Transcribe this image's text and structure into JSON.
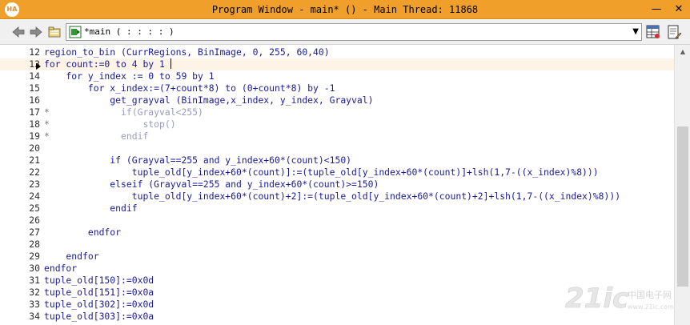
{
  "window": {
    "title": "Program Window - main* () - Main Thread: 11868",
    "app_icon": "HA",
    "minimize_glyph": "—",
    "close_glyph": "✕"
  },
  "toolbar": {
    "back_icon": "arrow-left-icon",
    "forward_icon": "arrow-right-icon",
    "procedure_value": "*main ( : : : : )",
    "dropdown_icon": "chevron-down-icon"
  },
  "editor": {
    "current_line_index": 1,
    "lines": [
      {
        "num": "12",
        "star": "",
        "code": "region_to_bin (CurrRegions, BinImage, 0, 255, 60,40)",
        "comment": false
      },
      {
        "num": "13",
        "star": "",
        "code": "for count:=0 to 4 by 1 ",
        "comment": false
      },
      {
        "num": "14",
        "star": "",
        "code": "    for y_index := 0 to 59 by 1",
        "comment": false
      },
      {
        "num": "15",
        "star": "",
        "code": "        for x_index:=(7+count*8) to (0+count*8) by -1",
        "comment": false
      },
      {
        "num": "16",
        "star": "",
        "code": "            get_grayval (BinImage,x_index, y_index, Grayval)",
        "comment": false
      },
      {
        "num": "17",
        "star": "*",
        "code": "              if(Grayval<255)",
        "comment": true
      },
      {
        "num": "18",
        "star": "*",
        "code": "                  stop()",
        "comment": true
      },
      {
        "num": "19",
        "star": "*",
        "code": "              endif",
        "comment": true
      },
      {
        "num": "20",
        "star": "",
        "code": "",
        "comment": false
      },
      {
        "num": "21",
        "star": "",
        "code": "            if (Grayval==255 and y_index+60*(count)<150)",
        "comment": false
      },
      {
        "num": "22",
        "star": "",
        "code": "                tuple_old[y_index+60*(count)]:=(tuple_old[y_index+60*(count)]+lsh(1,7-((x_index)%8)))",
        "comment": false
      },
      {
        "num": "23",
        "star": "",
        "code": "            elseif (Grayval==255 and y_index+60*(count)>=150)",
        "comment": false
      },
      {
        "num": "24",
        "star": "",
        "code": "                tuple_old[y_index+60*(count)+2]:=(tuple_old[y_index+60*(count)+2]+lsh(1,7-((x_index)%8)))",
        "comment": false
      },
      {
        "num": "25",
        "star": "",
        "code": "            endif",
        "comment": false
      },
      {
        "num": "26",
        "star": "",
        "code": "",
        "comment": false
      },
      {
        "num": "27",
        "star": "",
        "code": "        endfor",
        "comment": false
      },
      {
        "num": "28",
        "star": "",
        "code": "",
        "comment": false
      },
      {
        "num": "29",
        "star": "",
        "code": "    endfor",
        "comment": false
      },
      {
        "num": "30",
        "star": "",
        "code": "endfor",
        "comment": false
      },
      {
        "num": "31",
        "star": "",
        "code": "tuple_old[150]:=0x0d",
        "comment": false
      },
      {
        "num": "32",
        "star": "",
        "code": "tuple_old[151]:=0x0a",
        "comment": false
      },
      {
        "num": "33",
        "star": "",
        "code": "tuple_old[302]:=0x0d",
        "comment": false
      },
      {
        "num": "34",
        "star": "",
        "code": "tuple_old[303]:=0x0a",
        "comment": false
      }
    ]
  },
  "watermark": {
    "text_latin": "21ic",
    "text_cn": "中国电子网",
    "url": "www.21ic.com"
  },
  "colors": {
    "titlebar": "#f0a02a",
    "code_text": "#1a1a96",
    "comment_text": "#9a9ac4",
    "current_line": "#fdf4e7"
  }
}
